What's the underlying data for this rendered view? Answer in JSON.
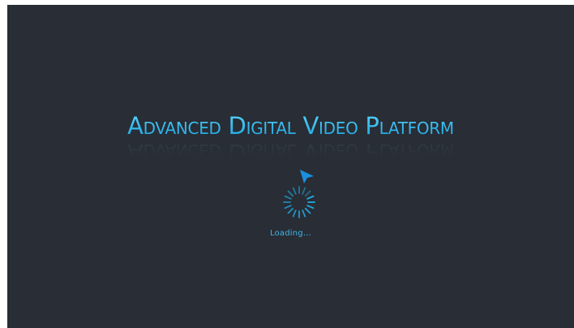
{
  "app": {
    "title": "Advanced Digital Video Platform"
  },
  "loading": {
    "label": "Loading...",
    "spinner_icon": "loading-spinner-icon",
    "cursor_icon": "pointer-cursor-icon"
  },
  "colors": {
    "background": "#292d35",
    "accent": "#1fb0ea",
    "accent_light": "#58d6ff",
    "cursor": "#1a8fe0"
  }
}
